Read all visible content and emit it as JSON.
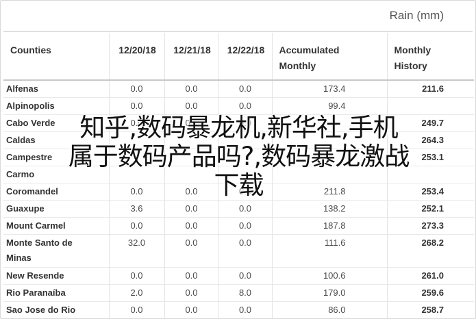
{
  "header": {
    "unit_title": "Rain (mm)"
  },
  "table": {
    "columns": [
      "Counties",
      "12/20/18",
      "12/21/18",
      "12/22/18",
      "Accumulated\nMonthly",
      "Monthly\nHistory"
    ],
    "rows": [
      {
        "county": "Alfenas",
        "d1": "0.0",
        "d2": "0.0",
        "d3": "0.0",
        "acc": "173.4",
        "hist": "211.6"
      },
      {
        "county": "Alpinopolis",
        "d1": "0.0",
        "d2": "0.0",
        "d3": "0.0",
        "acc": "99.4",
        "hist": ""
      },
      {
        "county": "Cabo Verde",
        "d1": "0.0",
        "d2": "0.2",
        "d3": "0.0",
        "acc": "",
        "hist": "249.7"
      },
      {
        "county": "Caldas",
        "d1": "",
        "d2": "",
        "d3": "",
        "acc": "",
        "hist": "264.3"
      },
      {
        "county": "Campestre",
        "d1": "",
        "d2": "",
        "d3": "",
        "acc": "",
        "hist": "253.1"
      },
      {
        "county": "Carmo",
        "d1": "",
        "d2": "",
        "d3": "",
        "acc": "",
        "hist": ""
      },
      {
        "county": "Coromandel",
        "d1": "0.0",
        "d2": "0.0",
        "d3": "0.0",
        "acc": "211.8",
        "hist": "253.4"
      },
      {
        "county": "Guaxupe",
        "d1": "3.6",
        "d2": "0.0",
        "d3": "0.0",
        "acc": "138.2",
        "hist": "252.1"
      },
      {
        "county": "Mount Carmel",
        "d1": "0.0",
        "d2": "0.0",
        "d3": "0.0",
        "acc": "187.8",
        "hist": "273.3"
      },
      {
        "county": "Monte Santo de\nMinas",
        "d1": "32.0",
        "d2": "0.0",
        "d3": "0.0",
        "acc": "111.6",
        "hist": "268.2"
      },
      {
        "county": "New Resende",
        "d1": "0.0",
        "d2": "0.0",
        "d3": "0.0",
        "acc": "100.6",
        "hist": "261.0"
      },
      {
        "county": "Rio Paranaíba",
        "d1": "2.0",
        "d2": "0.0",
        "d3": "8.0",
        "acc": "179.0",
        "hist": "259.6"
      },
      {
        "county": "Sao Jose do Rio\nPardo",
        "d1": "0.0",
        "d2": "0.0",
        "d3": "0.0",
        "acc": "86.0",
        "hist": "258.7"
      }
    ]
  },
  "overlay": {
    "line1": "知乎,数码暴龙机,新华社,手机",
    "line2": "属于数码产品吗?,数码暴龙激战",
    "line3": "下载"
  }
}
